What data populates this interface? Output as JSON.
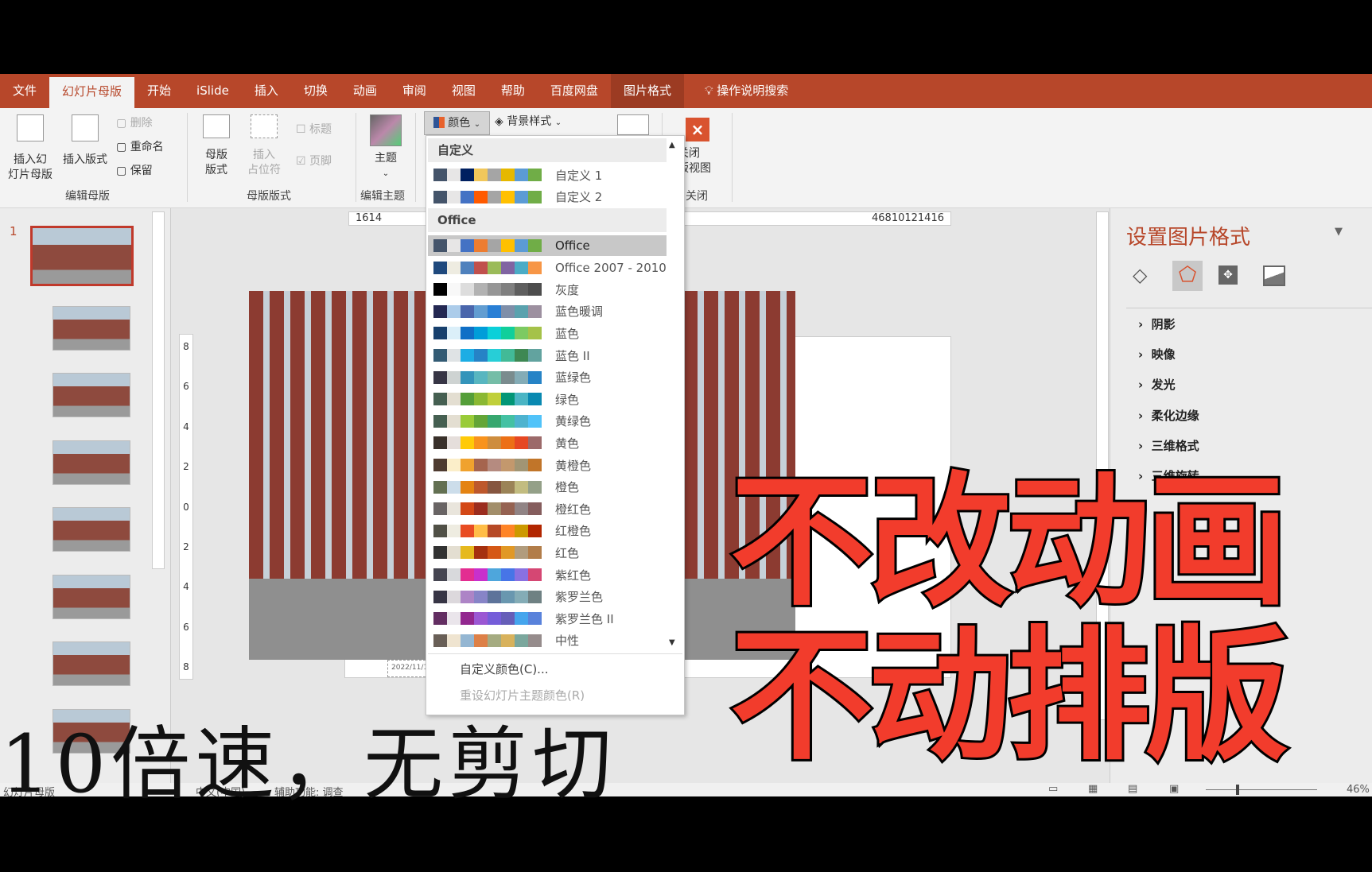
{
  "ribbon_tabs": [
    "文件",
    "幻灯片母版",
    "开始",
    "iSlide",
    "插入",
    "切换",
    "动画",
    "审阅",
    "视图",
    "帮助",
    "百度网盘",
    "图片格式"
  ],
  "active_tab": "幻灯片母版",
  "search": {
    "icon": "lightbulb-icon",
    "label": "操作说明搜索"
  },
  "ribbon": {
    "insert_master": "插入幻\n灯片母版",
    "insert_layout": "插入版式",
    "delete": "删除",
    "rename": "重命名",
    "preserve": "保留",
    "group_edit_master": "编辑母版",
    "master_layout": "母版\n版式",
    "insert_placeholder": "插入\n占位符",
    "title": "标题",
    "footer": "页脚",
    "group_master_layout": "母版版式",
    "theme": "主题",
    "group_edit_theme": "编辑主题",
    "colors": "颜色",
    "background_styles": "背景样式",
    "close": "关闭\n版视图",
    "group_close": "关闭"
  },
  "colors_dropdown": {
    "section_custom": "自定义",
    "custom": [
      {
        "name": "自定义 1",
        "colors": [
          "#44546a",
          "#e7e6e6",
          "#002060",
          "#f1c75b",
          "#a5a5a5",
          "#e5b800",
          "#5b9bd5",
          "#70ad47"
        ]
      },
      {
        "name": "自定义 2",
        "colors": [
          "#44546a",
          "#e7e6e6",
          "#4472c4",
          "#ff5a00",
          "#a5a5a5",
          "#ffc000",
          "#5b9bd5",
          "#70ad47"
        ]
      }
    ],
    "section_office": "Office",
    "office": [
      {
        "name": "Office",
        "selected": true,
        "colors": [
          "#44546a",
          "#e7e6e6",
          "#4472c4",
          "#ed7d31",
          "#a5a5a5",
          "#ffc000",
          "#5b9bd5",
          "#70ad47"
        ]
      },
      {
        "name": "Office 2007 - 2010",
        "colors": [
          "#1f497d",
          "#eeece1",
          "#4f81bd",
          "#c0504d",
          "#9bbb59",
          "#8064a2",
          "#4bacc6",
          "#f79646"
        ]
      },
      {
        "name": "灰度",
        "colors": [
          "#000000",
          "#f8f8f8",
          "#dddddd",
          "#b2b2b2",
          "#969696",
          "#808080",
          "#5f5f5f",
          "#4d4d4d"
        ]
      },
      {
        "name": "蓝色暖调",
        "colors": [
          "#242852",
          "#acccea",
          "#4a66ac",
          "#629dd1",
          "#297fd5",
          "#7f8fa9",
          "#5aa2ae",
          "#9d90a0"
        ]
      },
      {
        "name": "蓝色",
        "colors": [
          "#17406d",
          "#dbeff9",
          "#0f6fc6",
          "#009dd9",
          "#0bd0d9",
          "#10cf9b",
          "#7cca62",
          "#a5c249"
        ]
      },
      {
        "name": "蓝色 II",
        "colors": [
          "#335b74",
          "#dfe3e5",
          "#1cade4",
          "#2683c6",
          "#27ced7",
          "#42ba97",
          "#3e8853",
          "#62a39f"
        ]
      },
      {
        "name": "蓝绿色",
        "colors": [
          "#373545",
          "#ced3d2",
          "#3494ba",
          "#58b6c0",
          "#75bda7",
          "#7a8c8e",
          "#84acb6",
          "#2683c6"
        ]
      },
      {
        "name": "绿色",
        "colors": [
          "#455f51",
          "#e3ded1",
          "#549e39",
          "#8ab833",
          "#c0cf3a",
          "#029676",
          "#4ab5c4",
          "#0989b1"
        ]
      },
      {
        "name": "黄绿色",
        "colors": [
          "#455f51",
          "#e3ded1",
          "#99cb38",
          "#63a537",
          "#37a76f",
          "#44c1a3",
          "#4eb3cf",
          "#51c3f9"
        ]
      },
      {
        "name": "黄色",
        "colors": [
          "#39302a",
          "#e5dedb",
          "#ffca08",
          "#f8931d",
          "#ce8d3e",
          "#ec7016",
          "#e64823",
          "#9c6a6a"
        ]
      },
      {
        "name": "黄橙色",
        "colors": [
          "#4e3b30",
          "#fbeec9",
          "#f0a22e",
          "#a5644e",
          "#b58b80",
          "#c3986d",
          "#a19574",
          "#c17529"
        ]
      },
      {
        "name": "橙色",
        "colors": [
          "#637052",
          "#ccddea",
          "#e48312",
          "#bd582c",
          "#865640",
          "#9b8357",
          "#c2bc80",
          "#94a088"
        ]
      },
      {
        "name": "橙红色",
        "colors": [
          "#696464",
          "#e9e5dc",
          "#d34817",
          "#9b2d1f",
          "#a28e6a",
          "#956251",
          "#918485",
          "#855d5d"
        ]
      },
      {
        "name": "红橙色",
        "colors": [
          "#505046",
          "#eeece1",
          "#e84c22",
          "#ffbd47",
          "#b64926",
          "#ff8427",
          "#cc9900",
          "#b22600"
        ]
      },
      {
        "name": "红色",
        "colors": [
          "#323232",
          "#e3ded1",
          "#e6b91e",
          "#a5300f",
          "#d55816",
          "#e19825",
          "#b19c7d",
          "#b27d49"
        ]
      },
      {
        "name": "紫红色",
        "colors": [
          "#454551",
          "#d8d9dc",
          "#e32d91",
          "#c830cc",
          "#4ea6dc",
          "#4775e7",
          "#8971e1",
          "#d54773"
        ]
      },
      {
        "name": "紫罗兰色",
        "colors": [
          "#373545",
          "#dcd8dc",
          "#ad84c6",
          "#8784c7",
          "#5d739a",
          "#6997af",
          "#84acb6",
          "#6f8183"
        ]
      },
      {
        "name": "紫罗兰色 II",
        "colors": [
          "#632e62",
          "#eae5eb",
          "#92278f",
          "#9b57d3",
          "#755dd9",
          "#665eb8",
          "#45a5ed",
          "#5982db"
        ]
      },
      {
        "name": "中性",
        "colors": [
          "#695f57",
          "#efe4d0",
          "#94b6d2",
          "#dd8047",
          "#a5ab81",
          "#d8b25c",
          "#7ba79d",
          "#968c8c"
        ]
      }
    ],
    "customize": "自定义颜色(C)...",
    "reset": "重设幻灯片主题颜色(R)"
  },
  "slide_number": "1",
  "slide_date": "2022/11/1",
  "ruler_h": [
    "16",
    "14",
    "4",
    "6",
    "8",
    "10",
    "12",
    "14",
    "16"
  ],
  "ruler_v": [
    "8",
    "6",
    "4",
    "2",
    "0",
    "2",
    "4",
    "6",
    "8"
  ],
  "format_pane": {
    "title": "设置图片格式",
    "tab_icons": [
      "fill-line-icon",
      "effects-icon",
      "size-position-icon",
      "picture-icon"
    ],
    "active_tab_icon": "effects-icon",
    "items": [
      "阴影",
      "映像",
      "发光",
      "柔化边缘",
      "三维格式",
      "三维旋转"
    ]
  },
  "status": {
    "view": "幻灯片母版",
    "language": "中文(中国)",
    "accessibility": "辅助功能: 调查",
    "zoom": "46%"
  },
  "overlay": {
    "line1": "不改动画",
    "line2": "不动排版",
    "caption": "10倍速，无剪切",
    "accent": "#f23c2c"
  }
}
